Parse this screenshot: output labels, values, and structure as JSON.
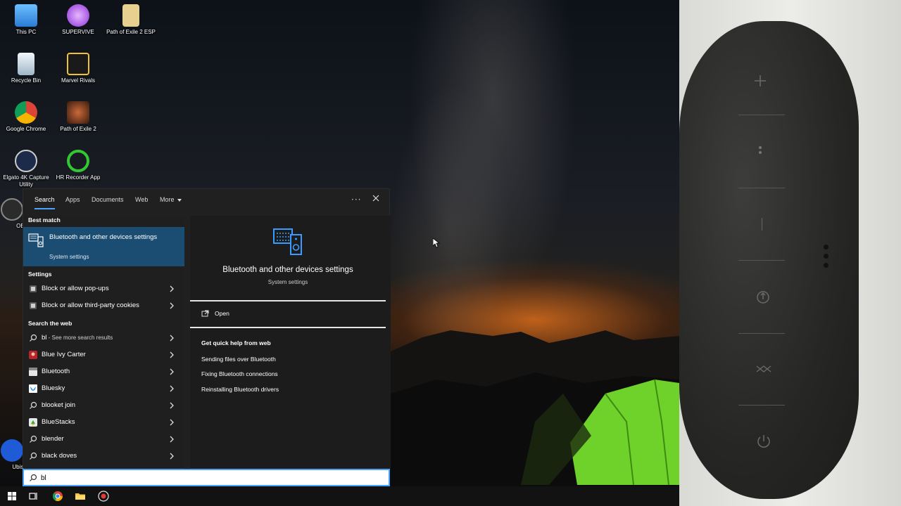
{
  "desktop_icons": [
    {
      "label": "This PC",
      "icon": "computer-icon",
      "color": "#4aa3ff"
    },
    {
      "label": "SUPERVIVE",
      "icon": "supervive-icon",
      "color": "#b65cf0"
    },
    {
      "label": "Path of Exile 2 ESP",
      "icon": "folder-file-icon",
      "color": "#e8d190"
    },
    {
      "label": "Recycle Bin",
      "icon": "recycle-bin-icon",
      "color": "#d7e6f2"
    },
    {
      "label": "Marvel Rivals",
      "icon": "marvel-rivals-icon",
      "color": "#f1c232"
    },
    {
      "label": "Google Chrome",
      "icon": "chrome-icon",
      "color": "#db4437"
    },
    {
      "label": "Path of Exile 2",
      "icon": "poe2-icon",
      "color": "#8a3b1a"
    },
    {
      "label": "Elgato 4K Capture Utility",
      "icon": "elgato-icon",
      "color": "#1d2b4a"
    },
    {
      "label": "HR Recorder App",
      "icon": "power-icon",
      "color": "#32c832"
    },
    {
      "label": "OBS",
      "icon": "obs-icon",
      "color": "#333"
    },
    {
      "label": "Ubisof",
      "icon": "ubisoft-icon",
      "color": "#1f5bd6"
    }
  ],
  "search_panel": {
    "tabs": [
      "Search",
      "Apps",
      "Documents",
      "Web",
      "More"
    ],
    "active_tab": "Search",
    "more_icon": "ellipsis-icon",
    "close_icon": "close-icon",
    "best_match_heading": "Best match",
    "best_match": {
      "title": "Bluetooth and other devices settings",
      "subtitle": "System settings",
      "icon": "bluetooth-devices-icon"
    },
    "settings_heading": "Settings",
    "settings_items": [
      {
        "label": "Block or allow pop-ups",
        "icon": "settings-icon"
      },
      {
        "label": "Block or allow third-party cookies",
        "icon": "settings-icon"
      }
    ],
    "web_heading": "Search the web",
    "web_items": [
      {
        "label": "bl",
        "sub": " - See more search results",
        "icon": "search-icon"
      },
      {
        "label": "Blue Ivy Carter",
        "icon": "web-result-icon"
      },
      {
        "label": "Bluetooth",
        "icon": "web-result-icon"
      },
      {
        "label": "Bluesky",
        "icon": "bluesky-icon"
      },
      {
        "label": "blooket join",
        "icon": "search-icon"
      },
      {
        "label": "BlueStacks",
        "icon": "bluestacks-icon"
      },
      {
        "label": "blender",
        "icon": "search-icon"
      },
      {
        "label": "black doves",
        "icon": "search-icon"
      }
    ],
    "detail": {
      "title": "Bluetooth and other devices settings",
      "subtitle": "System settings",
      "open_label": "Open",
      "help_title": "Get quick help from web",
      "help_links": [
        "Sending files over Bluetooth",
        "Fixing Bluetooth connections",
        "Reinstalling Bluetooth drivers"
      ]
    }
  },
  "search_box": {
    "value": "bl",
    "icon": "search-icon"
  },
  "taskbar": {
    "items": [
      "start-icon",
      "task-view-icon",
      "chrome-icon",
      "file-explorer-icon",
      "recorder-icon"
    ]
  },
  "colors": {
    "accent": "#4aa3ff",
    "selection": "#1b4d72",
    "panel": "#202020"
  }
}
